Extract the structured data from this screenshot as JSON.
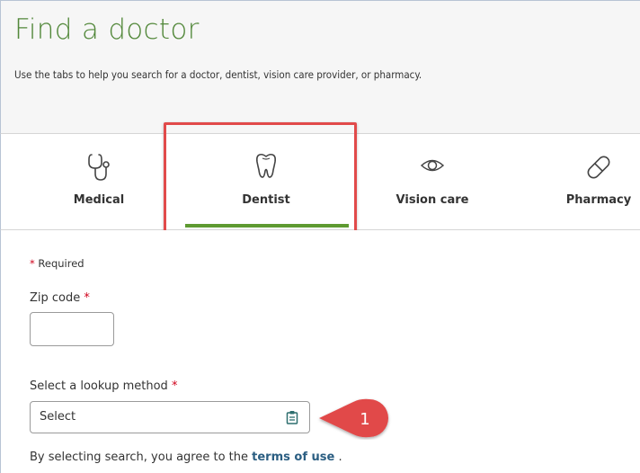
{
  "header": {
    "title": "Find a doctor",
    "subtitle": "Use the tabs to help you search for a doctor, dentist, vision care provider, or pharmacy."
  },
  "tabs": [
    {
      "label": "Medical",
      "icon": "stethoscope-icon"
    },
    {
      "label": "Dentist",
      "icon": "tooth-icon",
      "selected": true
    },
    {
      "label": "Vision care",
      "icon": "eye-icon"
    },
    {
      "label": "Pharmacy",
      "icon": "pill-icon"
    }
  ],
  "form": {
    "required_note": "Required",
    "required_marker": "*",
    "zip": {
      "label": "Zip code",
      "value": ""
    },
    "lookup": {
      "label": "Select a lookup method",
      "value": "Select"
    },
    "terms_prefix": "By selecting search, you agree to the",
    "terms_link": "terms of use",
    "terms_suffix": "."
  },
  "annotation": {
    "number": "1",
    "color": "#e14a4a"
  },
  "colors": {
    "accent_green": "#5e9a31",
    "title_green": "#52883a",
    "link": "#2b5e82",
    "required": "#d0021b"
  }
}
